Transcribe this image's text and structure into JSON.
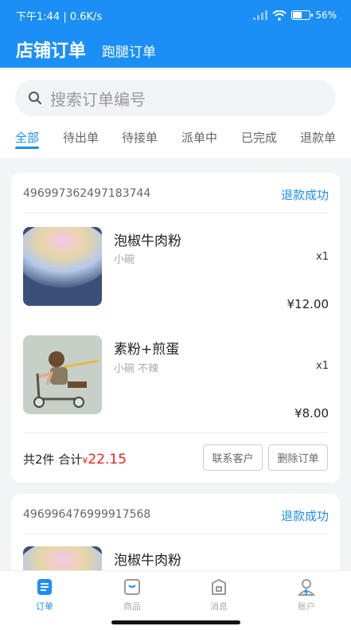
{
  "status_bar": {
    "time": "下午1:44",
    "speed": "0.6K/s",
    "battery_text": "56",
    "battery_level": 0.56
  },
  "header": {
    "tab_active": "店铺订单",
    "tab_other": "跑腿订单"
  },
  "search": {
    "placeholder": "搜索订单编号"
  },
  "filters": [
    "全部",
    "待出单",
    "待接单",
    "派单中",
    "已完成",
    "退款单"
  ],
  "orders": [
    {
      "order_no": "496997362497183744",
      "status": "退款成功",
      "items": [
        {
          "name": "泡椒牛肉粉",
          "spec": "小碗",
          "qty": "x1",
          "price": "¥12.00"
        },
        {
          "name": "素粉+煎蛋",
          "spec": "小碗 不辣",
          "qty": "x1",
          "price": "¥8.00"
        }
      ],
      "count_text": "共2件",
      "total_label": "合计",
      "total_currency": "¥",
      "total_amount": "22.15",
      "buttons": [
        "联系客户",
        "删除订单"
      ]
    },
    {
      "order_no": "496996476999917568",
      "status": "退款成功",
      "items": [
        {
          "name": "泡椒牛肉粉"
        }
      ]
    }
  ],
  "tabbar": [
    "订单",
    "商品",
    "消息",
    "账户"
  ],
  "colors": {
    "primary": "#1b8ff5",
    "price_red": "#e22222"
  }
}
